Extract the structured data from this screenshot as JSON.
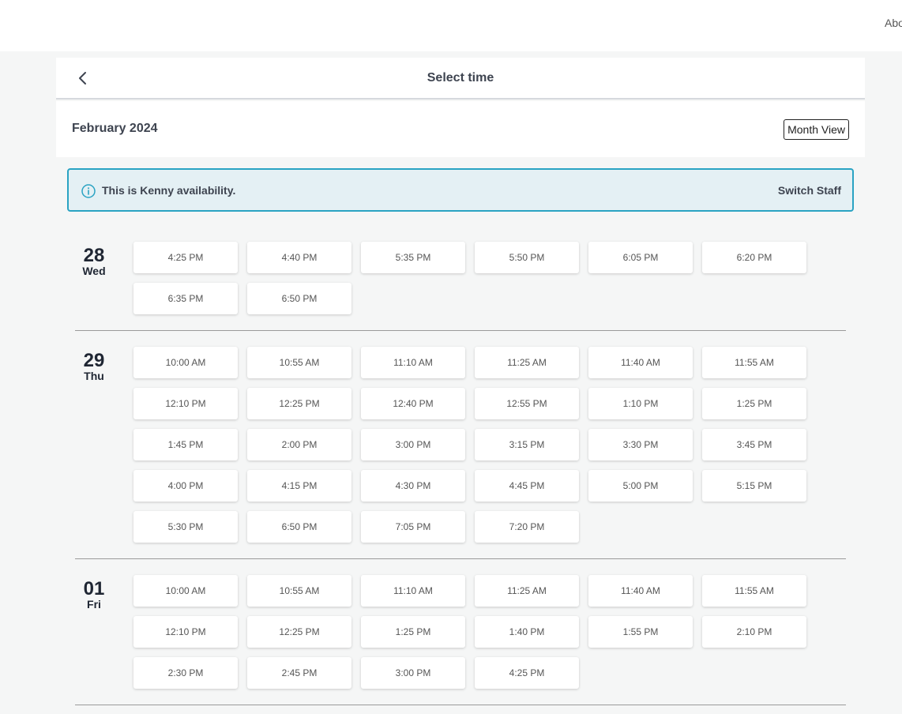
{
  "topbar": {
    "link_label": "Abo"
  },
  "header": {
    "title": "Select time",
    "back_icon": "chevron-left-icon"
  },
  "month_bar": {
    "month": "February 2024",
    "view_button": "Month View"
  },
  "notice": {
    "icon": "info-icon",
    "text": "This is Kenny availability.",
    "action": "Switch Staff",
    "accent_color": "#2aa3c3"
  },
  "days": [
    {
      "num": "28",
      "name": "Wed",
      "slots": [
        "4:25 PM",
        "4:40 PM",
        "5:35 PM",
        "5:50 PM",
        "6:05 PM",
        "6:20 PM",
        "6:35 PM",
        "6:50 PM"
      ]
    },
    {
      "num": "29",
      "name": "Thu",
      "slots": [
        "10:00 AM",
        "10:55 AM",
        "11:10 AM",
        "11:25 AM",
        "11:40 AM",
        "11:55 AM",
        "12:10 PM",
        "12:25 PM",
        "12:40 PM",
        "12:55 PM",
        "1:10 PM",
        "1:25 PM",
        "1:45 PM",
        "2:00 PM",
        "3:00 PM",
        "3:15 PM",
        "3:30 PM",
        "3:45 PM",
        "4:00 PM",
        "4:15 PM",
        "4:30 PM",
        "4:45 PM",
        "5:00 PM",
        "5:15 PM",
        "5:30 PM",
        "6:50 PM",
        "7:05 PM",
        "7:20 PM"
      ]
    },
    {
      "num": "01",
      "name": "Fri",
      "slots": [
        "10:00 AM",
        "10:55 AM",
        "11:10 AM",
        "11:25 AM",
        "11:40 AM",
        "11:55 AM",
        "12:10 PM",
        "12:25 PM",
        "1:25 PM",
        "1:40 PM",
        "1:55 PM",
        "2:10 PM",
        "2:30 PM",
        "2:45 PM",
        "3:00 PM",
        "4:25 PM"
      ]
    }
  ]
}
